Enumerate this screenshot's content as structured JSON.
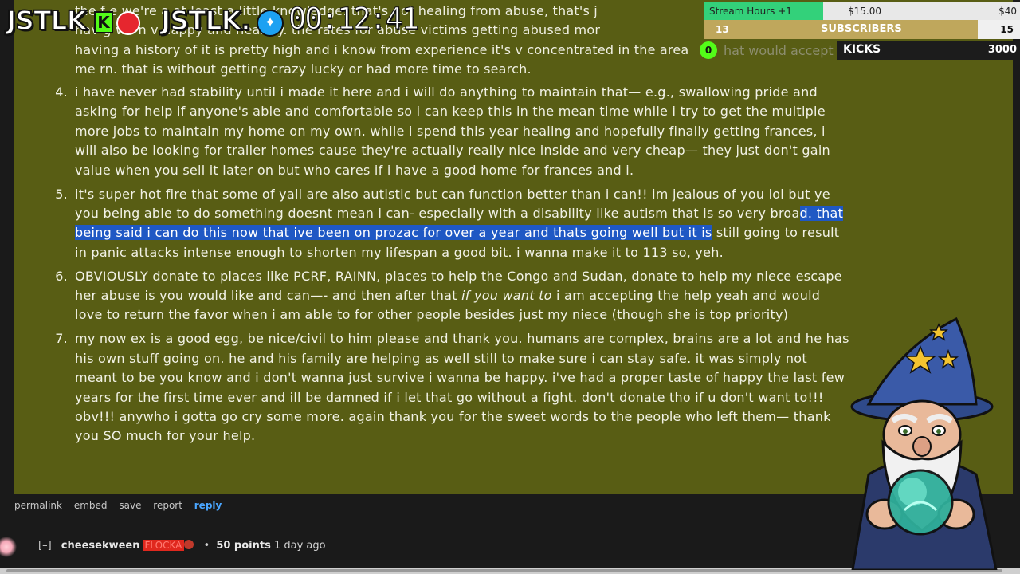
{
  "comment": {
    "partial_lines": [
      "the f  e  we're         a        at least a little knowledge. that's not healing from abuse, that's j",
      "hav g  wa     n          v   happy and healthy. the rates for abuse victims getting abused mor",
      "having a history of it is pretty high and i know from experience it's v concentrated in the area",
      "me rn. that is without getting crazy lucky or had more time to search."
    ],
    "items": [
      {
        "number": "4.",
        "text": "i have never had stability until i made it here and i will do anything to maintain that— e.g., swallowing pride and asking for help if anyone's able and comfortable so i can keep this in the mean time while i try to get the multiple more jobs to maintain my home on my own. while i spend this year healing and hopefully finally getting frances, i will also be looking for trailer homes cause they're actually really nice inside and very cheap— they just don't gain value when you sell it later on but who cares if i have a good home for frances and i."
      },
      {
        "number": "5.",
        "text_before": "it's super hot fire that some of yall are also autistic but can function better than i can!! im jealous of you lol but ye you being able to do something doesnt mean i can- especially with a disability like autism that is so very broa",
        "text_selected": "d. that being said i can do this now that ive been on prozac for over a year and thats going well but it is",
        "text_after": " still going to result in panic attacks intense enough to shorten my lifespan a good bit. i wanna make it to 113 so, yeh."
      },
      {
        "number": "6.",
        "text_before": "OBVIOUSLY donate to places like PCRF, RAINN, places to help the Congo and Sudan, donate to help my niece escape her abuse is you would like and can—- and then after that ",
        "text_italic": "if you want to",
        "text_after": " i am accepting the help yeah and would love to return the favor when i am able to for other people besides just my niece (though she is top priority)"
      },
      {
        "number": "7.",
        "text": "my now ex is a good egg, be nice/civil to him please and thank you. humans are complex, brains are a lot and he has his own stuff going on. he and his family are helping as well still to make sure i can stay safe. it was simply not meant to be you know and i don't wanna just survive i wanna be happy. i've had a proper taste of happy the last few years for the first time ever and ill be damned if i let that go without a fight. don't donate tho if u don't want to!!! obv!!! anywho i gotta go cry some more. again thank you for the sweet words to the people who left them— thank you SO much for your help."
      }
    ]
  },
  "actions": {
    "permalink": "permalink",
    "embed": "embed",
    "save": "save",
    "report": "report",
    "reply": "reply"
  },
  "next_comment": {
    "toggle": "[–]",
    "username": "cheesekween",
    "flair": "FLOCKA",
    "points": "50 points",
    "time": "1 day ago"
  },
  "overlay": {
    "logo_text": "JSTLK",
    "logo_text2": "JSTLK.",
    "timer": "00:12:41",
    "goal_stream_hours": {
      "label": "Stream Hours +1",
      "current": "$15.00",
      "target": "$40",
      "progress": 0.375
    },
    "goal_subscribers": {
      "label": "SUBSCRIBERS",
      "current": "13",
      "target": "15",
      "progress": 0.8667
    },
    "goal_kicks": {
      "label": "KICKS",
      "current": "0",
      "target": "3000",
      "ghost_text": "hat would accept"
    }
  },
  "colors": {
    "comment_bg": "#585d14",
    "selection": "#1f58c4",
    "reply_link": "#4aa6ff",
    "stream_green": "#33d17a",
    "kick_green": "#53fc18"
  }
}
